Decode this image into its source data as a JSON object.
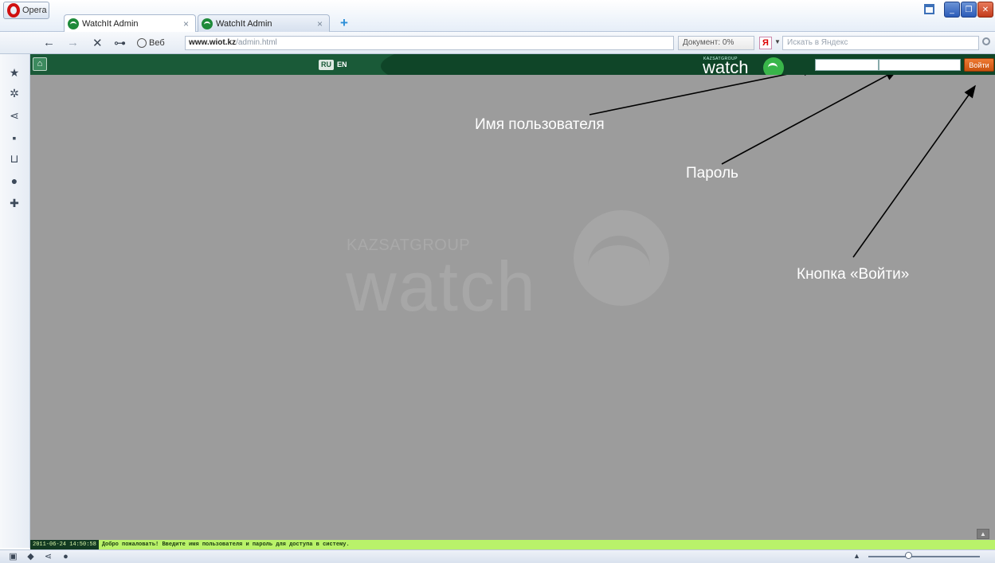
{
  "browser": {
    "menu_label": "Opera",
    "tabs": [
      {
        "title": "WatchIt Admin",
        "close": "×"
      },
      {
        "title": "WatchIt Admin",
        "close": "×"
      }
    ],
    "new_tab": "+",
    "nav": {
      "back": "←",
      "forward": "→",
      "stop": "✕",
      "key": "⊶"
    },
    "web_label": "Веб",
    "address_domain": "www.wiot.kz",
    "address_path": "/admin.html",
    "doc_status": "Документ:  0%",
    "search_placeholder": "Искать в Яндекс",
    "yandex_logo": "Я",
    "window_buttons": {
      "minimize": "_",
      "restore": "❐",
      "close": "✕"
    }
  },
  "app": {
    "home": "⌂",
    "lang_ru": "RU",
    "lang_en": "EN",
    "brand_small": "KAZSATGROUP",
    "brand": "watch",
    "username_value": "",
    "password_value": "",
    "login_label": "Войти"
  },
  "watermark": {
    "company": "KAZSATGROUP",
    "brand": "watch"
  },
  "annotations": {
    "username": "Имя пользователя",
    "password": "Пароль",
    "login_button": "Кнопка «Войти»"
  },
  "status": {
    "timestamp": "2011-06-24 14:50:58",
    "message": "Добро пожаловать! Введите имя пользователя и пароль для доступа в систему."
  },
  "colors": {
    "header_green": "#1a5a38",
    "content_grey": "#9c9c9c",
    "status_green": "#b9f26a",
    "login_orange": "#e06a22"
  },
  "side_icons": [
    "star-icon",
    "gear-icon",
    "share-icon",
    "notes-icon",
    "mail-icon",
    "clock-icon",
    "plus-icon"
  ]
}
